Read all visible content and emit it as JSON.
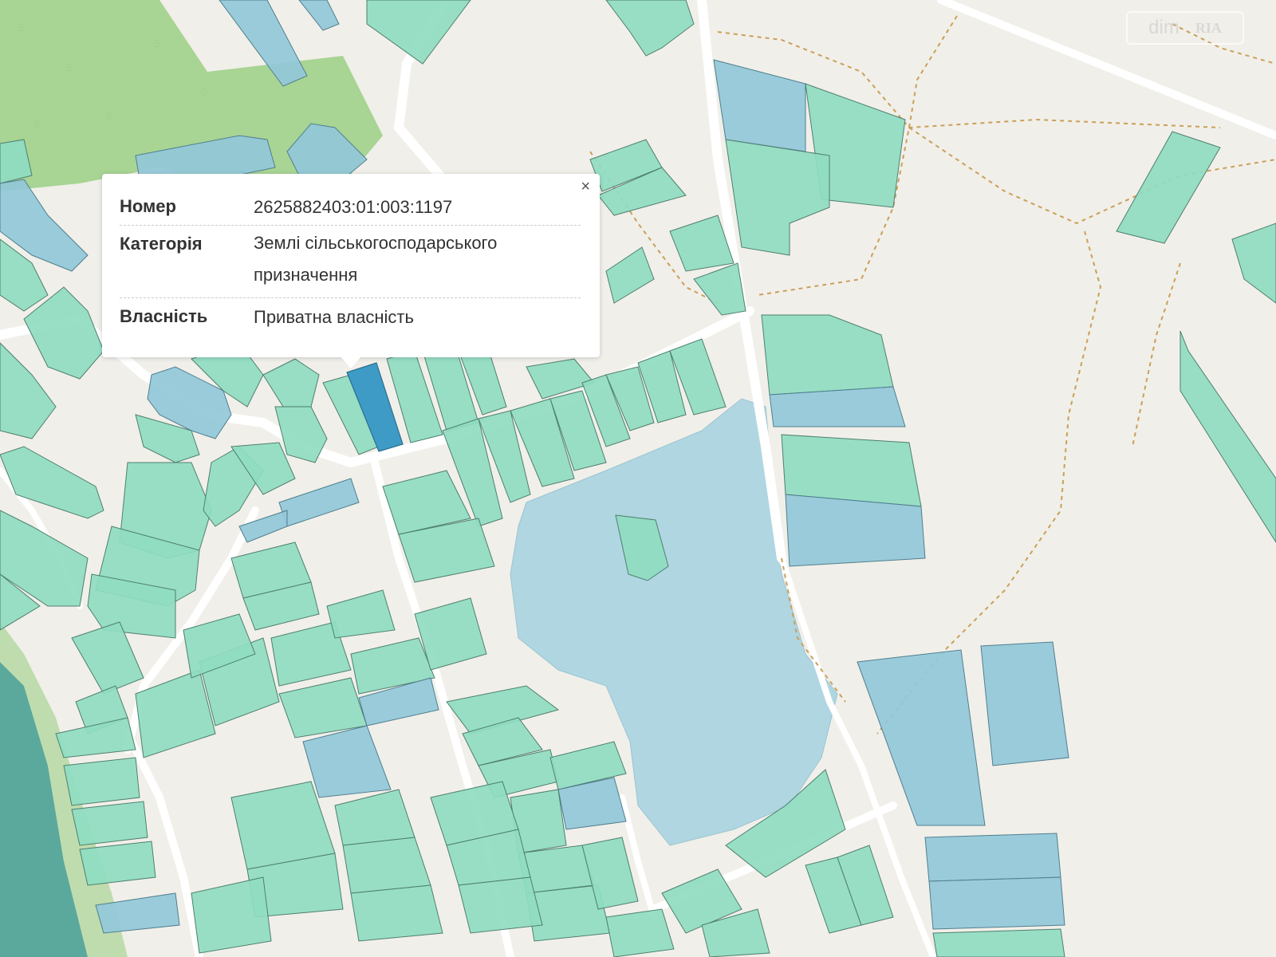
{
  "popup": {
    "close_label": "×",
    "rows": [
      {
        "label": "Номер",
        "value": "2625882403:01:003:1197"
      },
      {
        "label": "Категорія",
        "value": "Землі сільськогосподарського призначення"
      },
      {
        "label": "Власність",
        "value": "Приватна власність"
      }
    ]
  },
  "watermark": {
    "left": "dim",
    "right": "RIA"
  },
  "colors": {
    "background": "#f1efe9",
    "parcel_green": "#8fdcc1",
    "parcel_blue": "#93c8d9",
    "parcel_selected": "#3d9bc6",
    "forest": "#a8d494",
    "water": "#b0d6e2",
    "river": "#5ba99c",
    "road": "#ffffff",
    "path": "#c9a05a"
  },
  "icons": {
    "close": "close-icon",
    "tree": "tree-icon"
  }
}
